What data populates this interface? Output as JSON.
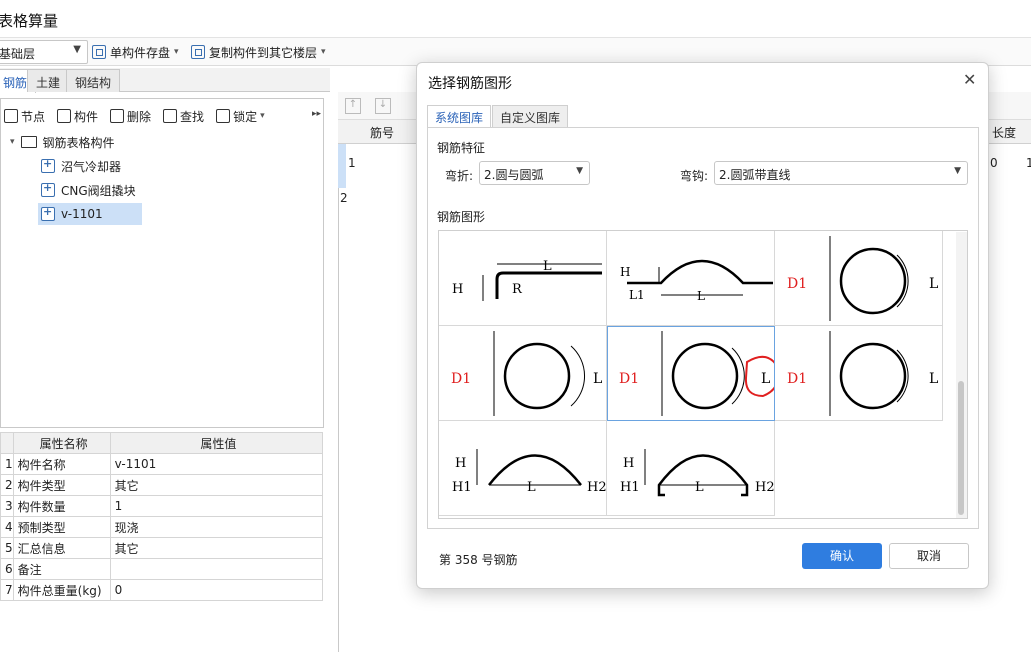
{
  "window": {
    "title": "表格算量"
  },
  "toolbar": {
    "floor": "基础层",
    "single_save": "单构件存盘",
    "copy_to_floor": "复制构件到其它楼层"
  },
  "tabs": [
    "钢筋",
    "土建",
    "钢结构"
  ],
  "left_toolbar": {
    "node": "节点",
    "component": "构件",
    "delete": "删除",
    "find": "查找",
    "lock": "锁定"
  },
  "tree": {
    "root": "钢筋表格构件",
    "items": [
      "沼气冷却器",
      "CNG阀组撬块",
      "v-1101"
    ]
  },
  "properties": {
    "headers": [
      "属性名称",
      "属性值"
    ],
    "rows": [
      {
        "no": "1",
        "name": "构件名称",
        "value": "v-1101"
      },
      {
        "no": "2",
        "name": "构件类型",
        "value": "其它"
      },
      {
        "no": "3",
        "name": "构件数量",
        "value": "1"
      },
      {
        "no": "4",
        "name": "预制类型",
        "value": "现浇"
      },
      {
        "no": "5",
        "name": "汇总信息",
        "value": "其它"
      },
      {
        "no": "6",
        "name": "备注",
        "value": ""
      },
      {
        "no": "7",
        "name": "构件总重量(kg)",
        "value": "0"
      }
    ]
  },
  "grid": {
    "col_bar_no": "筋号",
    "col_length": "长度",
    "row1": "1",
    "row2": "2",
    "cell_a": "0",
    "cell_b": "1"
  },
  "dialog": {
    "title": "选择钢筋图形",
    "tab_system": "系统图库",
    "tab_custom": "自定义图库",
    "section_feature": "钢筋特征",
    "bend_label": "弯折:",
    "bend_value": "2.圆与圆弧",
    "hook_label": "弯钩:",
    "hook_value": "2.圆弧带直线",
    "section_shape": "钢筋图形",
    "status": "第 358 号钢筋",
    "ok": "确认",
    "cancel": "取消"
  },
  "shape_labels": {
    "H": "H",
    "L": "L",
    "R": "R",
    "L1": "L1",
    "D1": "D1",
    "H1": "H1",
    "H2": "H2"
  },
  "colors": {
    "accent": "#2f7de0",
    "dimension_red": "#e02020",
    "selection": "#cce0f7"
  }
}
